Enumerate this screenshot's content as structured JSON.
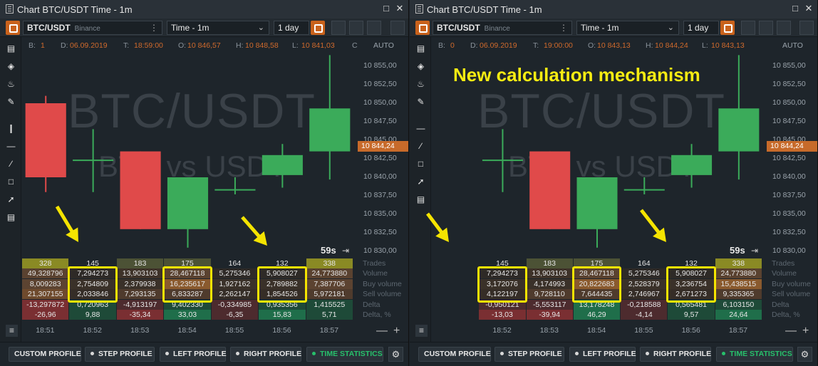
{
  "colors": {
    "up": "#3bab5a",
    "down": "#e04a4a",
    "accent": "#c9621c",
    "highlight": "#f5e400",
    "active_green": "#27c06b"
  },
  "panels": [
    {
      "window_title": "Chart BTC/USDT Time - 1m",
      "symbol": "BTC/USDT",
      "exchange": "Binance",
      "timeframe": "Time - 1m",
      "period": "1 day",
      "info": {
        "b_label": "B:",
        "b": "1",
        "d_label": "D:",
        "d": "06.09.2019",
        "t_label": "T:",
        "t": "18:59:00",
        "o_label": "O:",
        "o": "10 846,57",
        "h_label": "H:",
        "h": "10 848,58",
        "l_label": "L:",
        "l": "10 841,03",
        "c_label": "C"
      },
      "auto_label": "AUTO",
      "watermark_main": "BTC/USDT",
      "watermark_sub": "BTC vs USDT",
      "announcement": "",
      "price_ticks": [
        "10 855,00",
        "10 852,50",
        "10 850,00",
        "10 847,50",
        "10 845,00",
        "10 842,50",
        "10 840,00",
        "10 837,50",
        "10 835,00",
        "10 832,50",
        "10 830,00"
      ],
      "current_price": "10 844,24",
      "timer": "59s",
      "row_labels": [
        "Trades",
        "Volume",
        "Buy volume",
        "Sell volume",
        "Delta",
        "Delta, %"
      ],
      "columns": [
        {
          "time": "18:51",
          "trades": "328",
          "volume": "49,328796",
          "buy": "8,009283",
          "sell": "21,307155",
          "delta": "-13,297872",
          "delta_pct": "-26,96",
          "open": 10850.0,
          "high": 10851.0,
          "low": 10838.0,
          "close": 10840.0
        },
        {
          "time": "18:52",
          "trades": "145",
          "volume": "7,294273",
          "buy": "2,754809",
          "sell": "2,033846",
          "delta": "0,720963",
          "delta_pct": "9,88",
          "open": 10842.3,
          "high": 10846.5,
          "low": 10838.0,
          "close": 10842.3
        },
        {
          "time": "18:53",
          "trades": "183",
          "volume": "13,903103",
          "buy": "2,379938",
          "sell": "7,293135",
          "delta": "-4,913197",
          "delta_pct": "-35,34",
          "open": 10843.5,
          "high": 10843.5,
          "low": 10833.0,
          "close": 10833.0
        },
        {
          "time": "18:54",
          "trades": "175",
          "volume": "28,467118",
          "buy": "16,235617",
          "sell": "6,833287",
          "delta": "9,402330",
          "delta_pct": "33,03",
          "open": 10833.0,
          "high": 10840.0,
          "low": 10830.5,
          "close": 10840.0
        },
        {
          "time": "18:55",
          "trades": "164",
          "volume": "5,275346",
          "buy": "1,927162",
          "sell": "2,262147",
          "delta": "-0,334985",
          "delta_pct": "-6,35",
          "open": 10838.3,
          "high": 10840.0,
          "low": 10837.7,
          "close": 10838.3
        },
        {
          "time": "18:56",
          "trades": "132",
          "volume": "5,908027",
          "buy": "2,789882",
          "sell": "1,854526",
          "delta": "0,935356",
          "delta_pct": "15,83",
          "open": 10840.3,
          "high": 10844.5,
          "low": 10838.6,
          "close": 10843.0
        },
        {
          "time": "18:57",
          "trades": "338",
          "volume": "24,773880",
          "buy": "7,387706",
          "sell": "5,972181",
          "delta": "1,415525",
          "delta_pct": "5,71",
          "open": 10843.5,
          "high": 10856.5,
          "low": 10839.7,
          "close": 10849.3
        }
      ],
      "highlight_cols": [
        1,
        3,
        5
      ]
    },
    {
      "window_title": "Chart BTC/USDT Time - 1m",
      "symbol": "BTC/USDT",
      "exchange": "Binance",
      "timeframe": "Time - 1m",
      "period": "1 day",
      "info": {
        "b_label": "B:",
        "b": "0",
        "d_label": "D:",
        "d": "06.09.2019",
        "t_label": "T:",
        "t": "19:00:00",
        "o_label": "O:",
        "o": "10 843,13",
        "h_label": "H:",
        "h": "10 844,24",
        "l_label": "L:",
        "l": "10 843,13",
        "c_label": ""
      },
      "auto_label": "AUTO",
      "watermark_main": "BTC/USDT",
      "watermark_sub": "BTC vs USDT",
      "announcement": "New calculation mechanism",
      "price_ticks": [
        "10 855,00",
        "10 852,50",
        "10 850,00",
        "10 847,50",
        "10 845,00",
        "10 842,50",
        "10 840,00",
        "10 837,50",
        "10 835,00",
        "10 832,50",
        "10 830,00"
      ],
      "current_price": "10 844,24",
      "timer": "59s",
      "row_labels": [
        "Trades",
        "Volume",
        "Buy volume",
        "Sell volume",
        "Delta",
        "Delta, %"
      ],
      "columns": [
        {
          "time": "18:52",
          "trades": "145",
          "volume": "7,294273",
          "buy": "3,172076",
          "sell": "4,122197",
          "delta": "-0,950121",
          "delta_pct": "-13,03",
          "open": 10842.3,
          "high": 10846.5,
          "low": 10838.0,
          "close": 10842.3
        },
        {
          "time": "18:53",
          "trades": "183",
          "volume": "13,903103",
          "buy": "4,174993",
          "sell": "9,728110",
          "delta": "-5,553117",
          "delta_pct": "-39,94",
          "open": 10843.5,
          "high": 10843.5,
          "low": 10833.0,
          "close": 10833.0
        },
        {
          "time": "18:54",
          "trades": "175",
          "volume": "28,467118",
          "buy": "20,822683",
          "sell": "7,644435",
          "delta": "13,178248",
          "delta_pct": "46,29",
          "open": 10833.0,
          "high": 10840.0,
          "low": 10830.5,
          "close": 10840.0
        },
        {
          "time": "18:55",
          "trades": "164",
          "volume": "5,275346",
          "buy": "2,528379",
          "sell": "2,746967",
          "delta": "-0,218588",
          "delta_pct": "-4,14",
          "open": 10838.3,
          "high": 10840.0,
          "low": 10837.7,
          "close": 10838.3
        },
        {
          "time": "18:56",
          "trades": "132",
          "volume": "5,908027",
          "buy": "3,236754",
          "sell": "2,671273",
          "delta": "0,565481",
          "delta_pct": "9,57",
          "open": 10840.3,
          "high": 10844.5,
          "low": 10838.6,
          "close": 10843.0
        },
        {
          "time": "18:57",
          "trades": "338",
          "volume": "24,773880",
          "buy": "15,438515",
          "sell": "9,335365",
          "delta": "6,103150",
          "delta_pct": "24,64",
          "open": 10843.5,
          "high": 10856.5,
          "low": 10839.7,
          "close": 10849.3
        }
      ],
      "highlight_cols": [
        0,
        2,
        4
      ]
    }
  ],
  "profile_buttons": [
    "CUSTOM PROFILE",
    "STEP PROFILE",
    "LEFT PROFILE",
    "RIGHT PROFILE",
    "TIME STATISTICS"
  ],
  "icons": {
    "window": "window-icon",
    "maximize": "maximize-icon",
    "close": "close-icon",
    "settings": "gear-icon",
    "list": "list-icon",
    "arrow": "arrow-icon"
  }
}
